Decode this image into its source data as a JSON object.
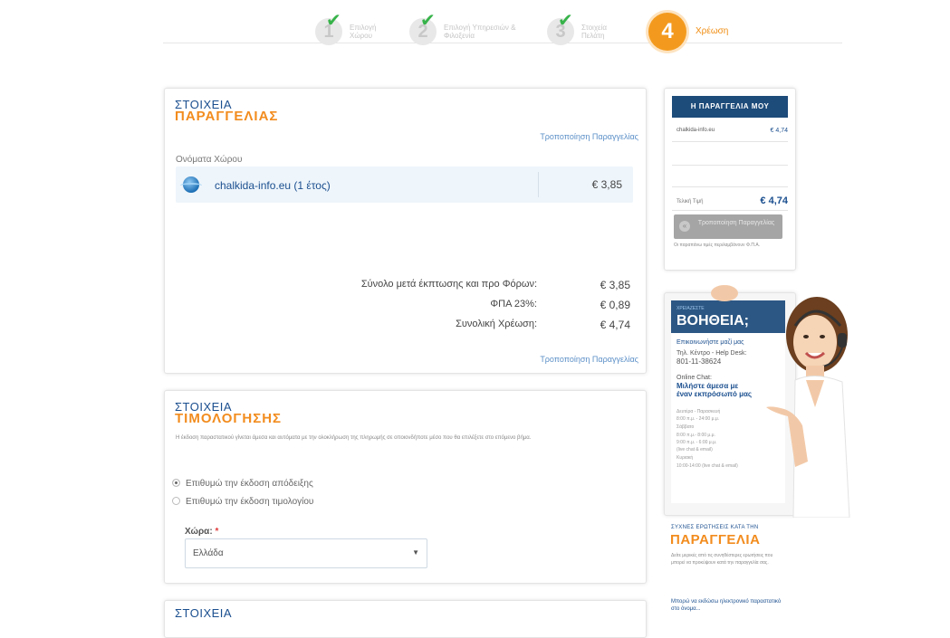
{
  "steps": [
    {
      "number": "1",
      "label": "Επιλογή Χώρου",
      "done": true
    },
    {
      "number": "2",
      "label": "Επιλογή Υπηρεσιών & Φιλοξενία",
      "done": true
    },
    {
      "number": "3",
      "label": "Στοιχεία Πελάτη",
      "done": true
    },
    {
      "number": "4",
      "label": "Χρέωση",
      "done": false,
      "active": true
    }
  ],
  "order": {
    "title_line1": "ΣΤΟΙΧΕΙΑ",
    "title_line2": "ΠΑΡΑΓΓΕΛΙΑΣ",
    "modify_link": "Τροποποίηση Παραγγελίας",
    "column_header": "Ονόματα Χώρου",
    "items": [
      {
        "name": "chalkida-info.eu (1 έτος)",
        "price": "€ 3,85"
      }
    ],
    "totals": [
      {
        "label": "Σύνολο μετά έκπτωσης και προ Φόρων:",
        "value": "€ 3,85"
      },
      {
        "label": "ΦΠΑ 23%:",
        "value": "€ 0,89"
      },
      {
        "label": "Συνολική Χρέωση:",
        "value": "€ 4,74"
      }
    ],
    "modify_link_bottom": "Τροποποίηση Παραγγελίας"
  },
  "billing": {
    "title_line1": "ΣΤΟΙΧΕΙΑ",
    "title_line2": "ΤΙΜΟΛΟΓΗΣΗΣ",
    "note": "Η έκδοση παραστατικού γίνεται άμεσα και αυτόματα με την ολοκλήρωση της πληρωμής σε οποιονδήποτε μέσο που θα επιλέξετε στο επόμενο βήμα.",
    "options": [
      {
        "label": "Επιθυμώ την έκδοση απόδειξης",
        "selected": true
      },
      {
        "label": "Επιθυμώ την έκδοση τιμολογίου",
        "selected": false
      }
    ],
    "country_label": "Χώρα:",
    "required_mark": "*",
    "country_value": "Ελλάδα"
  },
  "third_panel": {
    "title_line1": "ΣΤΟΙΧΕΙΑ"
  },
  "cart": {
    "title": "Η ΠΑΡΑΓΓΕΛΙΑ ΜΟΥ",
    "item_name": "chalkida-info.eu",
    "item_price": "€ 4,74",
    "total_label": "Τελική Τιμή",
    "total_value": "€ 4,74",
    "button_label": "Τροποποίηση Παραγγελίας",
    "footnote": "Οι παραπάνω τιμές περιλαμβάνουν Φ.Π.Α."
  },
  "help": {
    "small": "ΧΡΕΙΑΖΕΣΤΕ",
    "big": "ΒΟΗΘΕΙΑ;",
    "contact": "Επικοινωνήστε μαζί μας",
    "phone_label": "Τηλ. Κέντρο - Help Desk:",
    "phone": "801-11-38624",
    "chat_label": "Online Chat:",
    "chat_text": "Μιλήστε άμεσα με έναν εκπρόσωπό μας",
    "hours": [
      "Δευτέρα - Παρασκευή",
      "8:00 π.μ. - 24:00 μ.μ.",
      "Σάββατο",
      "8:00 π.μ.- 8:00 μ.μ.",
      "9:00 π.μ. - 6:00 μ.μ.",
      "(live chat & email)",
      "Κυριακή",
      "10:00-14:00 (live chat & email)"
    ]
  },
  "faq": {
    "line1": "ΣΥΧΝΕΣ ΕΡΩΤΗΣΕΙΣ ΚΑΤΑ ΤΗΝ",
    "line2": "ΠΑΡΑΓΓΕΛΙΑ",
    "text": "Δείτε μερικές από τις συνηθέστερες ερωτήσεις που μπορεί να προκύψουν κατά την παραγγελία σας.",
    "question": "Μπορώ να εκδώσω ηλεκτρονικό παραστατικό στο όνομα..."
  }
}
